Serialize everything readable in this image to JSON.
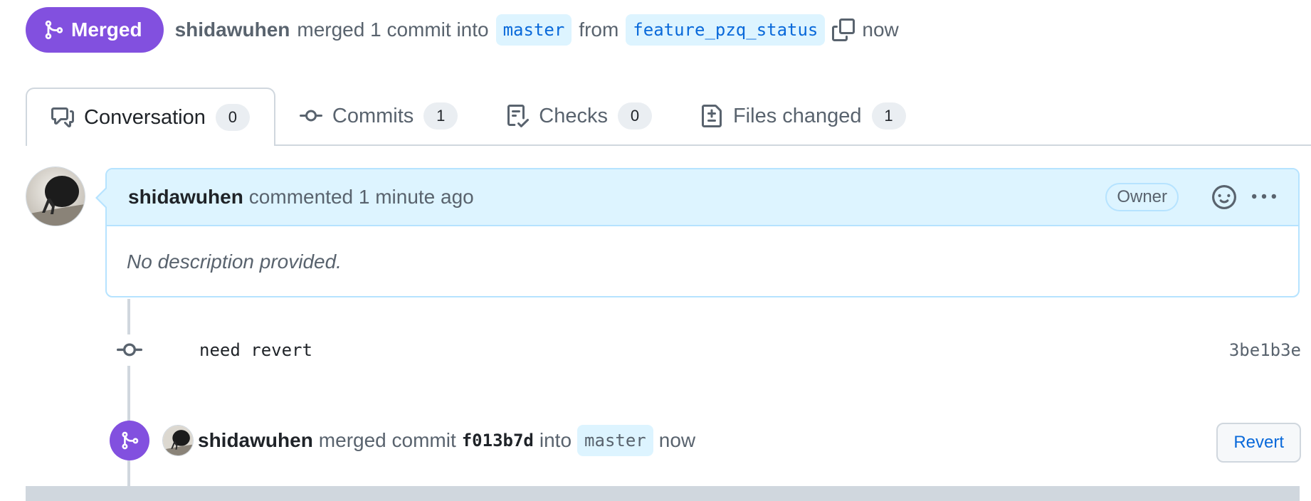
{
  "header": {
    "state_label": "Merged",
    "author": "shidawuhen",
    "merged_text": "merged 1 commit into",
    "base_branch": "master",
    "from_text": "from",
    "head_branch": "feature_pzq_status",
    "time": "now"
  },
  "tabs": [
    {
      "label": "Conversation",
      "count": "0",
      "icon": "comment-discussion-icon"
    },
    {
      "label": "Commits",
      "count": "1",
      "icon": "git-commit-icon"
    },
    {
      "label": "Checks",
      "count": "0",
      "icon": "checklist-icon"
    },
    {
      "label": "Files changed",
      "count": "1",
      "icon": "file-diff-icon"
    }
  ],
  "comment": {
    "author": "shidawuhen",
    "action": "commented 1 minute ago",
    "role_badge": "Owner",
    "body": "No description provided."
  },
  "commit": {
    "message": "need revert",
    "sha": "3be1b3e"
  },
  "merge_event": {
    "author": "shidawuhen",
    "action": "merged commit",
    "sha": "f013b7d",
    "into_text": "into",
    "branch": "master",
    "time": "now",
    "revert_label": "Revert"
  },
  "colors": {
    "merged_purple": "#8250df",
    "link_blue": "#0969da",
    "header_bg": "#ddf4ff",
    "border": "#d0d7de"
  }
}
